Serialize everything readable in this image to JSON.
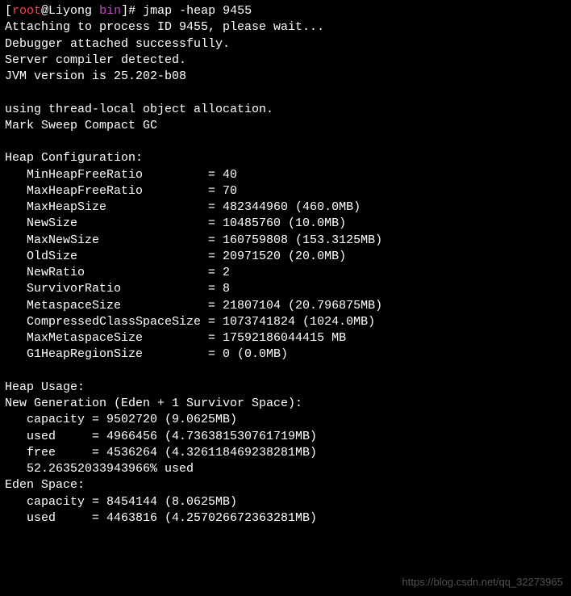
{
  "prompt": {
    "open_bracket": "[",
    "user": "root",
    "at": "@",
    "host": "Liyong ",
    "path": "bin",
    "close_bracket": "]# ",
    "command": "jmap -heap 9455"
  },
  "lines": {
    "l1": "Attaching to process ID 9455, please wait...",
    "l2": "Debugger attached successfully.",
    "l3": "Server compiler detected.",
    "l4": "JVM version is 25.202-b08",
    "l5": "",
    "l6": "using thread-local object allocation.",
    "l7": "Mark Sweep Compact GC",
    "l8": "",
    "l9": "Heap Configuration:",
    "l10": "   MinHeapFreeRatio         = 40",
    "l11": "   MaxHeapFreeRatio         = 70",
    "l12": "   MaxHeapSize              = 482344960 (460.0MB)",
    "l13": "   NewSize                  = 10485760 (10.0MB)",
    "l14": "   MaxNewSize               = 160759808 (153.3125MB)",
    "l15": "   OldSize                  = 20971520 (20.0MB)",
    "l16": "   NewRatio                 = 2",
    "l17": "   SurvivorRatio            = 8",
    "l18": "   MetaspaceSize            = 21807104 (20.796875MB)",
    "l19": "   CompressedClassSpaceSize = 1073741824 (1024.0MB)",
    "l20": "   MaxMetaspaceSize         = 17592186044415 MB",
    "l21": "   G1HeapRegionSize         = 0 (0.0MB)",
    "l22": "",
    "l23": "Heap Usage:",
    "l24": "New Generation (Eden + 1 Survivor Space):",
    "l25": "   capacity = 9502720 (9.0625MB)",
    "l26": "   used     = 4966456 (4.736381530761719MB)",
    "l27": "   free     = 4536264 (4.326118469238281MB)",
    "l28": "   52.26352033943966% used",
    "l29": "Eden Space:",
    "l30": "   capacity = 8454144 (8.0625MB)",
    "l31": "   used     = 4463816 (4.257026672363281MB)"
  },
  "watermark": "https://blog.csdn.net/qq_32273965"
}
